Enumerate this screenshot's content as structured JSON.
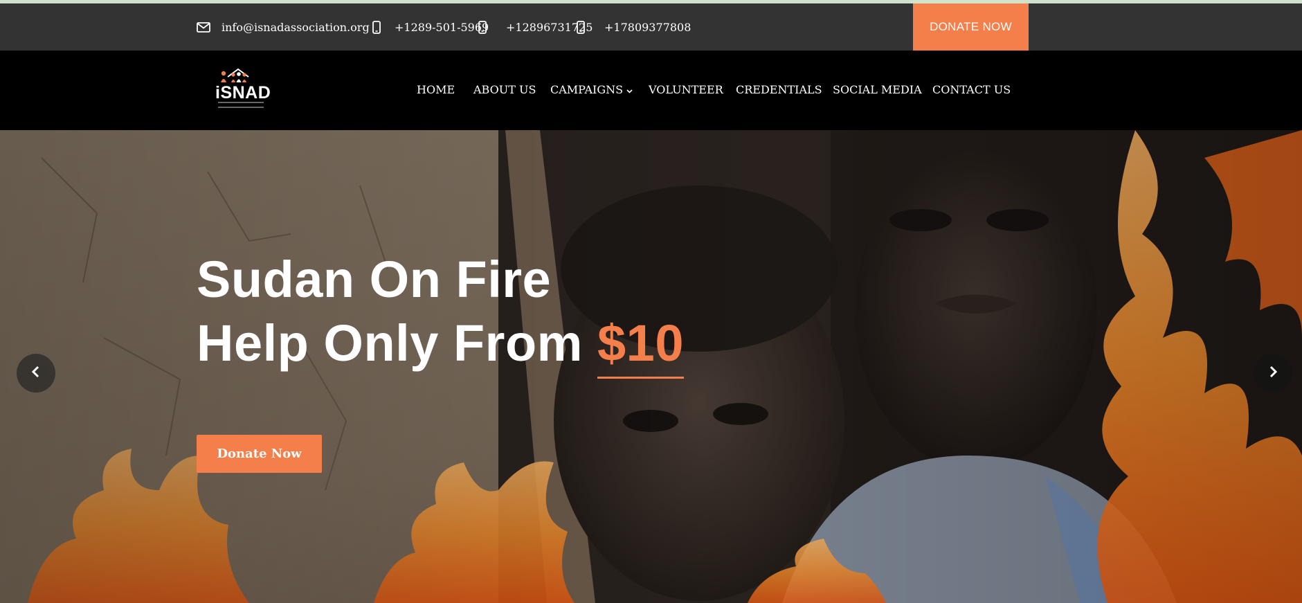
{
  "topbar": {
    "email": "info@isnadassociation.org",
    "phones": [
      "+1289-501-5969",
      "+12896731725",
      "+17809377808"
    ],
    "donate_label": "DONATE NOW"
  },
  "logo": {
    "text": "iSNAD"
  },
  "nav": {
    "items": [
      {
        "label": "HOME"
      },
      {
        "label": "ABOUT US"
      },
      {
        "label": "CAMPAIGNS",
        "has_dropdown": true
      },
      {
        "label": "VOLUNTEER"
      },
      {
        "label": "CREDENTIALS"
      },
      {
        "label": "SOCIAL MEDIA"
      },
      {
        "label": "CONTACT US"
      }
    ]
  },
  "hero": {
    "title_line1": "Sudan On Fire",
    "title_line2_prefix": "Help Only From ",
    "title_amount": "$10",
    "cta_label": "Donate Now"
  },
  "icons": {
    "email": "envelope-icon",
    "phone": "mobile-phone-icon",
    "dropdown": "chevron-down-icon",
    "prev": "chevron-left-icon",
    "next": "chevron-right-icon"
  },
  "colors": {
    "accent": "#f47f4b",
    "topbar_bg": "#333333",
    "navbar_bg": "#000000",
    "strip": "#cfe3cc"
  }
}
